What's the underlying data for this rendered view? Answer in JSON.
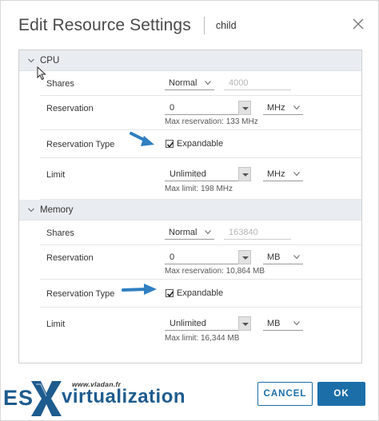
{
  "dialog": {
    "title": "Edit Resource Settings",
    "subtitle": "child",
    "close_icon": "close-icon"
  },
  "cpu": {
    "section_label": "CPU",
    "shares": {
      "label": "Shares",
      "level": "Normal",
      "value": "4000"
    },
    "reservation": {
      "label": "Reservation",
      "value": "0",
      "unit": "MHz",
      "hint": "Max reservation: 133 MHz"
    },
    "reservation_type": {
      "label": "Reservation Type",
      "checkbox_label": "Expandable",
      "checked": true
    },
    "limit": {
      "label": "Limit",
      "value": "Unlimited",
      "unit": "MHz",
      "hint": "Max limit: 198 MHz"
    }
  },
  "memory": {
    "section_label": "Memory",
    "shares": {
      "label": "Shares",
      "level": "Normal",
      "value": "163840"
    },
    "reservation": {
      "label": "Reservation",
      "value": "0",
      "unit": "MB",
      "hint": "Max reservation: 10,864 MB"
    },
    "reservation_type": {
      "label": "Reservation Type",
      "checkbox_label": "Expandable",
      "checked": true
    },
    "limit": {
      "label": "Limit",
      "value": "Unlimited",
      "unit": "MB",
      "hint": "Max limit: 16,344 MB"
    }
  },
  "buttons": {
    "cancel": "CANCEL",
    "ok": "OK"
  },
  "watermark": {
    "url": "www.vladan.fr",
    "brand_left": "ES",
    "brand_right": "virtualization"
  },
  "colors": {
    "accent": "#1b6ea8",
    "section_bg": "#e9edf1",
    "arrow": "#2f7fc1"
  }
}
